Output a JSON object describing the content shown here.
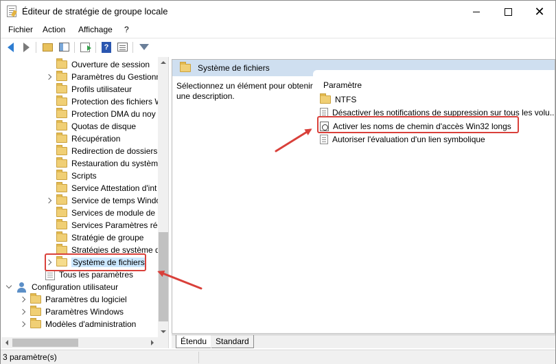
{
  "window": {
    "title": "Éditeur de stratégie de groupe locale",
    "controls": {
      "minimize": "",
      "maximize": "",
      "close": "✕"
    }
  },
  "menu": [
    "Fichier",
    "Action",
    "Affichage",
    "?"
  ],
  "toolbar": [
    "back-icon",
    "forward-icon",
    "folder-up-icon",
    "show-tree-icon",
    "export-icon",
    "help-icon",
    "properties-icon",
    "filter-icon"
  ],
  "tree": {
    "items": [
      {
        "label": "Ouverture de session",
        "expander": "none"
      },
      {
        "label": "Paramètres du Gestionn",
        "expander": "right"
      },
      {
        "label": "Profils utilisateur",
        "expander": "none"
      },
      {
        "label": "Protection des fichiers W",
        "expander": "none"
      },
      {
        "label": "Protection DMA du noy",
        "expander": "none"
      },
      {
        "label": "Quotas de disque",
        "expander": "none"
      },
      {
        "label": "Récupération",
        "expander": "none"
      },
      {
        "label": "Redirection de dossiers",
        "expander": "none"
      },
      {
        "label": "Restauration du systèm",
        "expander": "none"
      },
      {
        "label": "Scripts",
        "expander": "none"
      },
      {
        "label": "Service Attestation d'int",
        "expander": "none"
      },
      {
        "label": "Service de temps Windo",
        "expander": "right"
      },
      {
        "label": "Services de module de p",
        "expander": "none"
      },
      {
        "label": "Services Paramètres rég",
        "expander": "none"
      },
      {
        "label": "Stratégie de groupe",
        "expander": "none"
      },
      {
        "label": "Stratégies de système d",
        "expander": "none"
      },
      {
        "label": "Système de fichiers",
        "expander": "right"
      }
    ],
    "all_settings": "Tous les paramètres",
    "user_config": "Configuration utilisateur",
    "user_children": [
      "Paramètres du logiciel",
      "Paramètres Windows",
      "Modèles d'administration"
    ]
  },
  "right_pane": {
    "header_title": "Système de fichiers",
    "description": "Sélectionnez un élément pour obtenir une description.",
    "column_header": "Paramètre",
    "rows": [
      {
        "label": "NTFS",
        "icon": "folder-icon"
      },
      {
        "label": "Désactiver les notifications de suppression sur tous les volu...",
        "icon": "setting-icon"
      },
      {
        "label": "Activer les noms de chemin d'accès Win32 longs",
        "icon": "setting-enabled-icon"
      },
      {
        "label": "Autoriser l'évaluation d'un lien symbolique",
        "icon": "setting-icon"
      }
    ]
  },
  "tabs": [
    "Étendu",
    "Standard"
  ],
  "status": "3 paramètre(s)",
  "colors": {
    "highlight": "#d9403a",
    "header_bg": "#cfdff0",
    "selected_bg": "#cce8ff"
  }
}
